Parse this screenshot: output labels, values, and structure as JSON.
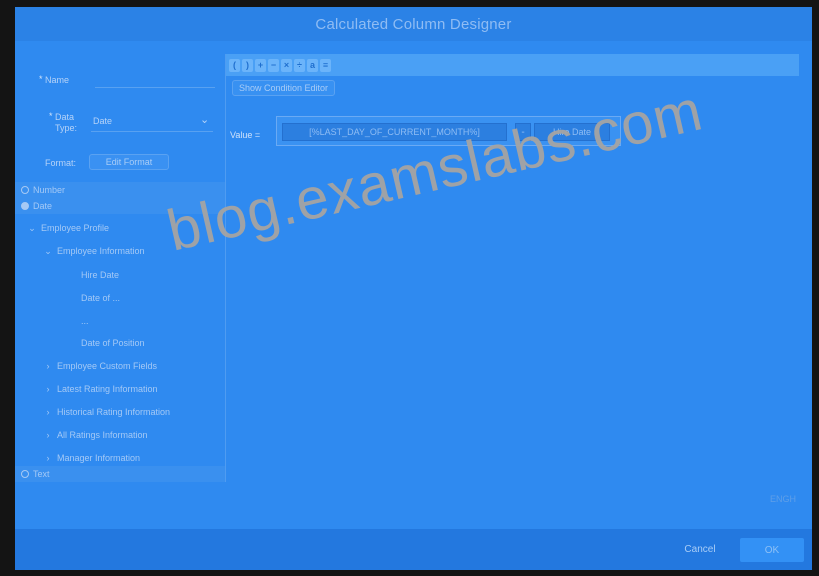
{
  "dialog": {
    "title": "Calculated Column Designer"
  },
  "form": {
    "name_label": "Name",
    "required_mark": "*",
    "data_type_label_1": "Data",
    "data_type_label_2": "Type:",
    "data_type_value": "Date",
    "format_label": "Format:",
    "edit_format_label": "Edit Format"
  },
  "tree": {
    "number_label": "Number",
    "date_label": "Date",
    "employee_profile": "Employee Profile",
    "employee_information": "Employee Information",
    "hire_date": "Hire Date",
    "date_of_item": "Date of ...",
    "item_partial": "...",
    "date_of_position": "Date of Position",
    "employee_custom_fields": "Employee Custom Fields",
    "latest_rating": "Latest Rating Information",
    "historical_rating": "Historical Rating Information",
    "all_ratings": "All Ratings Information",
    "manager_information": "Manager Information",
    "text_label": "Text"
  },
  "toolbar": {
    "buttons": [
      "(",
      ")",
      "+",
      "−",
      "×",
      "÷",
      "a",
      "≡"
    ]
  },
  "editor": {
    "show_condition_label": "Show Condition Editor",
    "value_label": "Value =",
    "expr_month": "[%LAST_DAY_OF_CURRENT_MONTH%]",
    "expr_operator": "-",
    "expr_hire_date": "Hire Date"
  },
  "footer": {
    "hint": "ENGH",
    "cancel_label": "Cancel",
    "ok_label": "OK"
  },
  "watermark": {
    "text": "blog.examslabs.com"
  }
}
